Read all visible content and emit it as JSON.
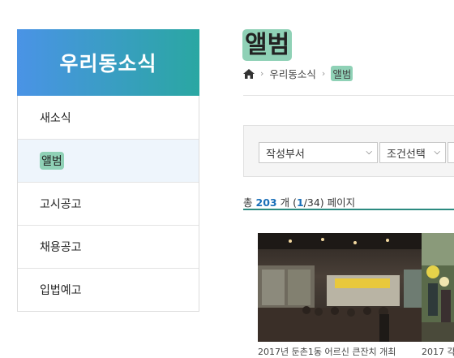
{
  "sidebar": {
    "title": "우리동소식",
    "items": [
      {
        "label": "새소식"
      },
      {
        "label": "앨범"
      },
      {
        "label": "고시공고"
      },
      {
        "label": "채용공고"
      },
      {
        "label": "입법예고"
      }
    ]
  },
  "page": {
    "title": "앨범"
  },
  "breadcrumb": {
    "icon": "home-icon",
    "items": [
      "우리동소식",
      "앨범"
    ]
  },
  "filters": {
    "dept": {
      "selected": "작성부서"
    },
    "condition": {
      "selected": "조건선택"
    }
  },
  "count": {
    "prefix": "총",
    "total": "203",
    "unit": "개",
    "open": "(",
    "current": "1",
    "total_pages": "/34",
    "close": ")",
    "suffix": "페이지"
  },
  "albums": [
    {
      "caption": "2017년 둔촌1동 어르신 큰잔치 개최"
    },
    {
      "caption": "2017 각"
    }
  ],
  "colors": {
    "header_start": "#4a93e6",
    "header_end": "#2aa7a2",
    "highlight": "#8fd1b6",
    "accent": "#2b8a80"
  }
}
